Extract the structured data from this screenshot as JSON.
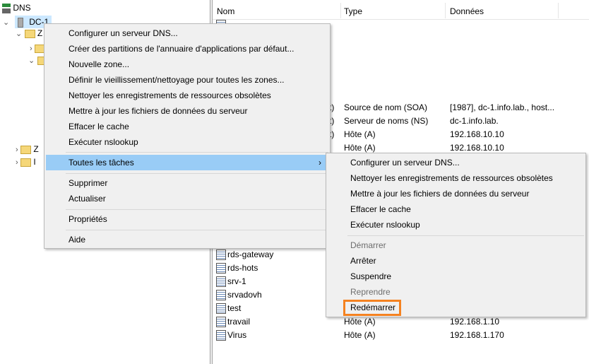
{
  "tree": {
    "root": "DNS",
    "server": "DC-1",
    "folders": [
      "Z",
      "Z",
      "I"
    ]
  },
  "columns": {
    "name": "Nom",
    "type": "Type",
    "data": "Données"
  },
  "records_top": [
    {
      "prefix": "t)",
      "type": "Source de nom (SOA)",
      "data": "[1987], dc-1.info.lab., host..."
    },
    {
      "prefix": "t)",
      "type": "Serveur de noms (NS)",
      "data": "dc-1.info.lab."
    },
    {
      "prefix": "t)",
      "type": "Hôte (A)",
      "data": "192.168.10.10"
    },
    {
      "prefix": "",
      "type": "Hôte (A)",
      "data": "192.168.10.10"
    }
  ],
  "records_bottom": [
    {
      "name": "rds-gateway",
      "type": "",
      "data": ""
    },
    {
      "name": "rds-hots",
      "type": "",
      "data": ""
    },
    {
      "name": "srv-1",
      "type": "",
      "data": ""
    },
    {
      "name": "srvadovh",
      "type": "",
      "data": ""
    },
    {
      "name": "test",
      "type": "",
      "data": ""
    },
    {
      "name": "travail",
      "type": "Hôte (A)",
      "data": "192.168.1.10"
    },
    {
      "name": "Virus",
      "type": "Hôte (A)",
      "data": "192.168.1.170"
    }
  ],
  "context_menu": {
    "items": [
      "Configurer un serveur DNS...",
      "Créer des partitions de l'annuaire d'applications par défaut...",
      "Nouvelle zone...",
      "Définir le vieillissement/nettoyage pour toutes les zones...",
      "Nettoyer les enregistrements de ressources obsolètes",
      "Mettre à jour les fichiers de données du serveur",
      "Effacer le cache",
      "Exécuter nslookup"
    ],
    "all_tasks": "Toutes les tâches",
    "arrow": "›",
    "items2": [
      "Supprimer",
      "Actualiser"
    ],
    "properties": "Propriétés",
    "help": "Aide"
  },
  "submenu": {
    "items": [
      "Configurer un serveur DNS...",
      "Nettoyer les enregistrements de ressources obsolètes",
      "Mettre à jour les fichiers de données du serveur",
      "Effacer le cache",
      "Exécuter nslookup"
    ],
    "service": [
      {
        "label": "Démarrer",
        "disabled": true
      },
      {
        "label": "Arrêter",
        "disabled": false
      },
      {
        "label": "Suspendre",
        "disabled": false
      },
      {
        "label": "Reprendre",
        "disabled": true
      },
      {
        "label": "Redémarrer",
        "disabled": false
      }
    ]
  },
  "colors": {
    "highlight": "#99ccf6",
    "accent": "#f58220"
  }
}
